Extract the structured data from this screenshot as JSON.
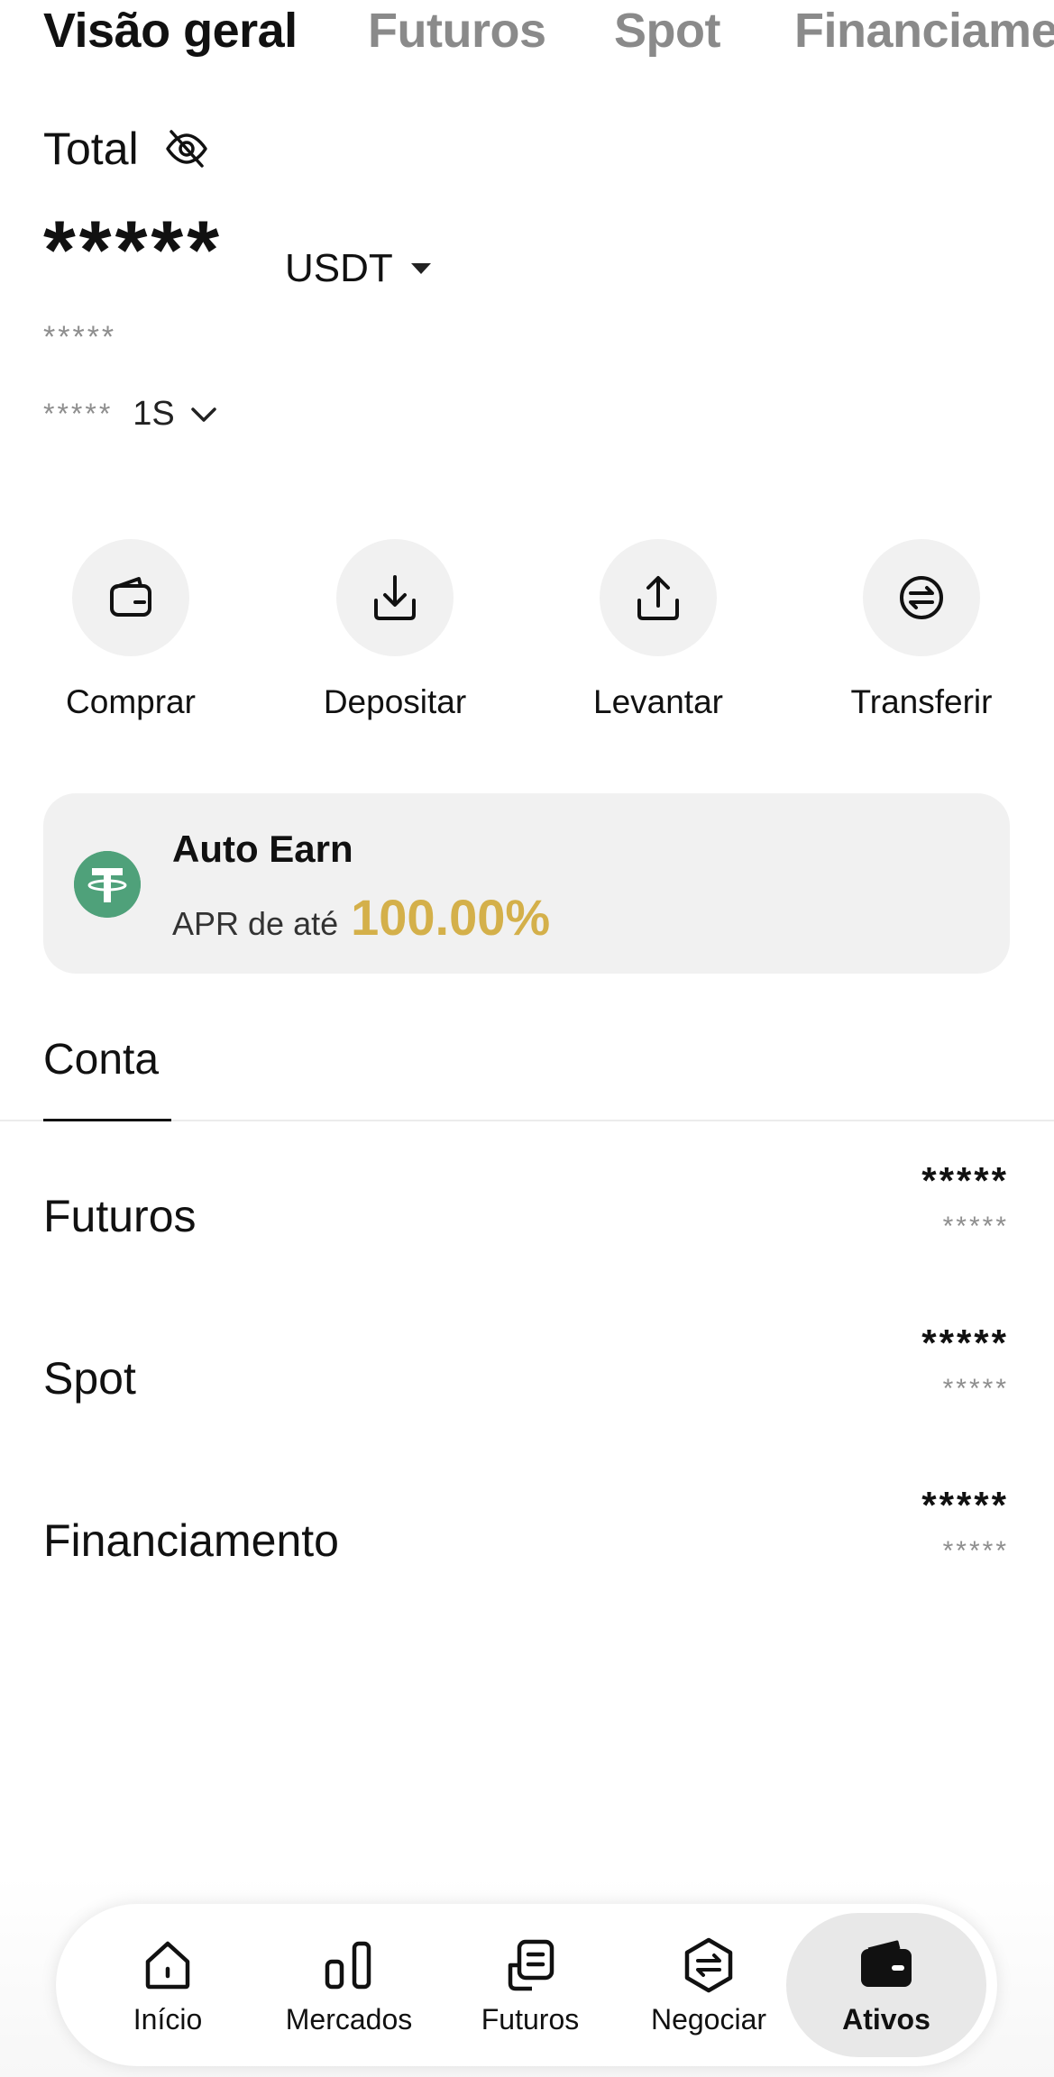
{
  "top_tabs": [
    {
      "label": "Visão geral",
      "active": true
    },
    {
      "label": "Futuros",
      "active": false
    },
    {
      "label": "Spot",
      "active": false
    },
    {
      "label": "Financiamento",
      "active": false
    }
  ],
  "total": {
    "label": "Total",
    "icon": "eye-off-icon",
    "balance_masked": "*****",
    "currency": "USDT",
    "fiat_masked": "*****",
    "pnl_masked": "*****",
    "period": "1S"
  },
  "actions": [
    {
      "label": "Comprar",
      "icon": "wallet-icon"
    },
    {
      "label": "Depositar",
      "icon": "download-icon"
    },
    {
      "label": "Levantar",
      "icon": "upload-icon"
    },
    {
      "label": "Transferir",
      "icon": "transfer-icon"
    }
  ],
  "promo": {
    "title": "Auto Earn",
    "apr_label": "APR de até",
    "apr_value": "100.00%",
    "icon": "tether-icon"
  },
  "account_section": {
    "tab_label": "Conta",
    "rows": [
      {
        "name": "Futuros",
        "value_masked": "*****",
        "sub_masked": "*****"
      },
      {
        "name": "Spot",
        "value_masked": "*****",
        "sub_masked": "*****"
      },
      {
        "name": "Financiamento",
        "value_masked": "*****",
        "sub_masked": "*****"
      }
    ]
  },
  "bottom_nav": [
    {
      "label": "Início",
      "icon": "home-icon",
      "active": false
    },
    {
      "label": "Mercados",
      "icon": "markets-icon",
      "active": false
    },
    {
      "label": "Futuros",
      "icon": "futures-icon",
      "active": false
    },
    {
      "label": "Negociar",
      "icon": "trade-icon",
      "active": false
    },
    {
      "label": "Ativos",
      "icon": "assets-wallet-icon",
      "active": true
    }
  ],
  "colors": {
    "accent_gold": "#d4b04a",
    "tether_green": "#4fa17a",
    "muted_text": "#8e8e8e",
    "card_bg": "#f1f1f1"
  }
}
